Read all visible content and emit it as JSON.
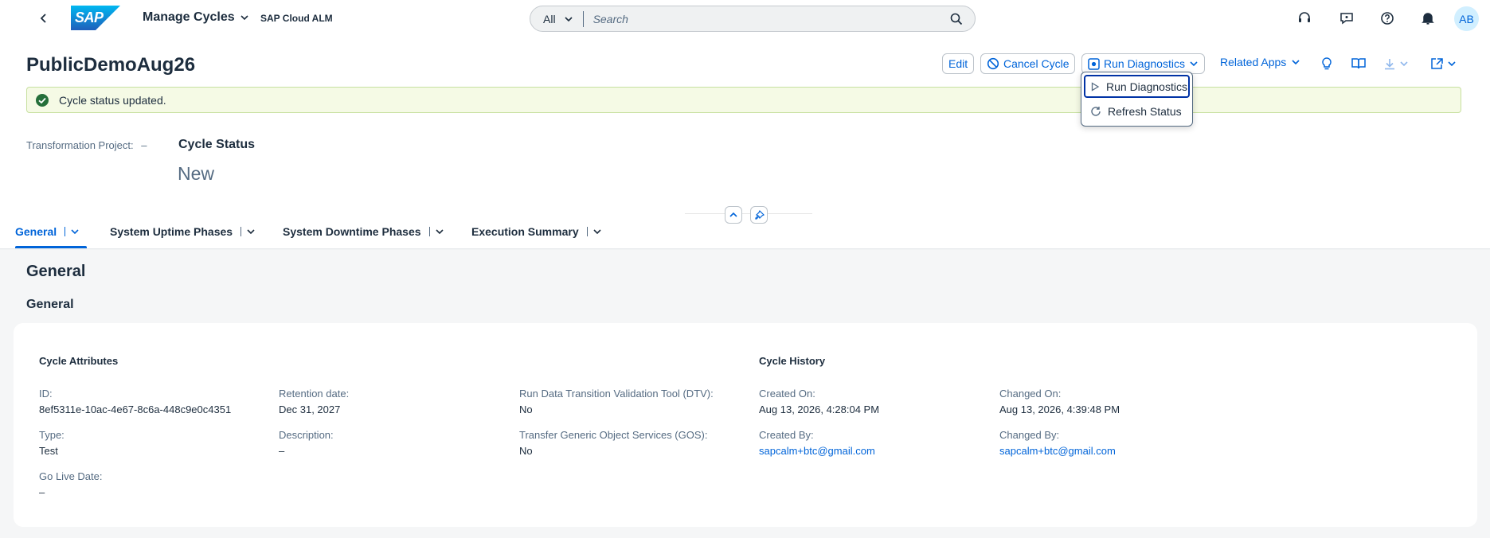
{
  "shell": {
    "logo_text": "SAP",
    "app_title": "Manage Cycles",
    "product_name": "SAP Cloud ALM",
    "search_scope": "All",
    "search_placeholder": "Search",
    "avatar_initials": "AB",
    "icons": [
      "back-icon",
      "support-icon",
      "feedback-icon",
      "help-icon",
      "notification-icon"
    ]
  },
  "object": {
    "title": "PublicDemoAug26"
  },
  "toolbar": {
    "edit_label": "Edit",
    "cancel_cycle_label": "Cancel Cycle",
    "run_diagnostics_label": "Run Diagnostics",
    "related_apps_label": "Related Apps"
  },
  "dropdown": {
    "items": [
      {
        "label": "Run Diagnostics",
        "icon": "play-icon",
        "focused": true
      },
      {
        "label": "Refresh Status",
        "icon": "refresh-icon",
        "focused": false
      }
    ]
  },
  "message": {
    "text": "Cycle status updated.",
    "color": "#256f3a"
  },
  "header_fields": {
    "transformation_project_label": "Transformation Project:",
    "transformation_project_value": "–",
    "cycle_status_label": "Cycle Status",
    "cycle_status_value": "New"
  },
  "tabs": [
    {
      "label": "General",
      "active": true
    },
    {
      "label": "System Uptime Phases",
      "active": false
    },
    {
      "label": "System Downtime Phases",
      "active": false
    },
    {
      "label": "Execution Summary",
      "active": false
    }
  ],
  "section": {
    "title": "General",
    "subtitle": "General"
  },
  "cycle_attributes": {
    "title": "Cycle Attributes",
    "id_label": "ID:",
    "id_value": "8ef5311e-10ac-4e67-8c6a-448c9e0c4351",
    "retention_label": "Retention date:",
    "retention_value": "Dec 31, 2027",
    "dtv_label": "Run Data Transition Validation Tool (DTV):",
    "dtv_value": "No",
    "type_label": "Type:",
    "type_value": "Test",
    "description_label": "Description:",
    "description_value": "–",
    "gos_label": "Transfer Generic Object Services (GOS):",
    "gos_value": "No",
    "golive_label": "Go Live Date:",
    "golive_value": "–"
  },
  "cycle_history": {
    "title": "Cycle History",
    "created_on_label": "Created On:",
    "created_on_value": "Aug 13, 2026, 4:28:04 PM",
    "changed_on_label": "Changed On:",
    "changed_on_value": "Aug 13, 2026, 4:39:48 PM",
    "created_by_label": "Created By:",
    "created_by_value": "sapcalm+btc@gmail.com",
    "changed_by_label": "Changed By:",
    "changed_by_value": "sapcalm+btc@gmail.com"
  },
  "colors": {
    "accent": "#0064d9",
    "text": "#1d2d3e",
    "muted": "#556b82",
    "success_bg": "#f5fae5"
  }
}
